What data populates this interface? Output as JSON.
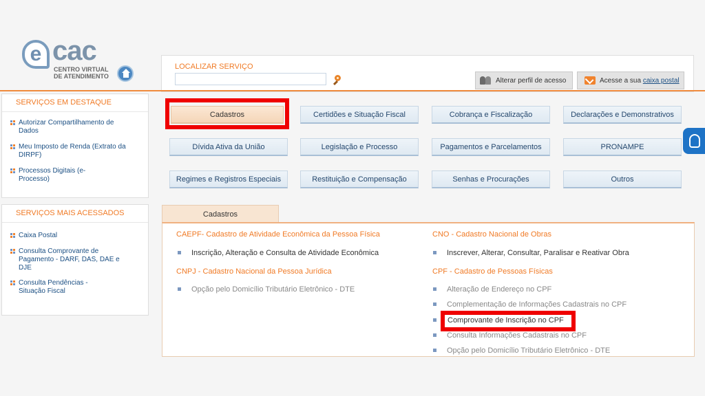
{
  "logo": {
    "cac": "cac",
    "e": "e",
    "line1": "CENTRO VIRTUAL",
    "line2": "DE ATENDIMENTO"
  },
  "search": {
    "label": "LOCALIZAR SERVIÇO",
    "value": "",
    "placeholder": ""
  },
  "header": {
    "profile_label": "Alterar perfil de acesso",
    "mailbox_prefix": "Acesse a sua ",
    "mailbox_link": "caixa postal"
  },
  "sidebar": {
    "featured_title": "SERVIÇOS EM DESTAQUE",
    "featured": [
      {
        "label": "Autorizar Compartilhamento de Dados"
      },
      {
        "label": "Meu Imposto de Renda (Extrato da DIRPF)"
      },
      {
        "label": "Processos Digitais (e-Processo)"
      }
    ],
    "most_title": "SERVIÇOS MAIS ACESSADOS",
    "most": [
      {
        "label": "Caixa Postal"
      },
      {
        "label": "Consulta Comprovante de Pagamento - DARF, DAS, DAE e DJE"
      },
      {
        "label": "Consulta Pendências - Situação Fiscal"
      }
    ]
  },
  "categories": [
    {
      "label": "Cadastros",
      "active": true
    },
    {
      "label": "Certidões e Situação Fiscal"
    },
    {
      "label": "Cobrança e Fiscalização"
    },
    {
      "label": "Declarações e Demonstrativos"
    },
    {
      "label": "Dívida Ativa da União"
    },
    {
      "label": "Legislação e Processo"
    },
    {
      "label": "Pagamentos e Parcelamentos"
    },
    {
      "label": "PRONAMPE"
    },
    {
      "label": "Regimes e Registros Especiais"
    },
    {
      "label": "Restituição e Compensação"
    },
    {
      "label": "Senhas e Procurações"
    },
    {
      "label": "Outros"
    }
  ],
  "panel": {
    "tab": "Cadastros",
    "left": [
      {
        "title": "CAEPF- Cadastro de Atividade Econômica da Pessoa Física",
        "items": [
          "Inscrição, Alteração e Consulta de Atividade Econômica"
        ]
      },
      {
        "title": "CNPJ - Cadastro Nacional da Pessoa Jurídica",
        "items": [
          "Opção pelo Domicílio Tributário Eletrônico - DTE"
        ]
      }
    ],
    "right": [
      {
        "title": "CNO - Cadastro Nacional de Obras",
        "items": [
          "Inscrever, Alterar, Consultar, Paralisar e Reativar Obra"
        ]
      },
      {
        "title": "CPF - Cadastro de Pessoas Físicas",
        "items": [
          "Alteração de Endereço no CPF",
          "Complementação de Informações Cadastrais no CPF",
          "Comprovante de Inscrição no CPF",
          "Consulta Informações Cadastrais no CPF",
          "Opção pelo Domicílio Tributário Eletrônico - DTE"
        ]
      }
    ]
  },
  "colors": {
    "accent_orange": "#f07a25",
    "highlight_red": "#ef0000",
    "link_blue": "#1b4f83"
  }
}
